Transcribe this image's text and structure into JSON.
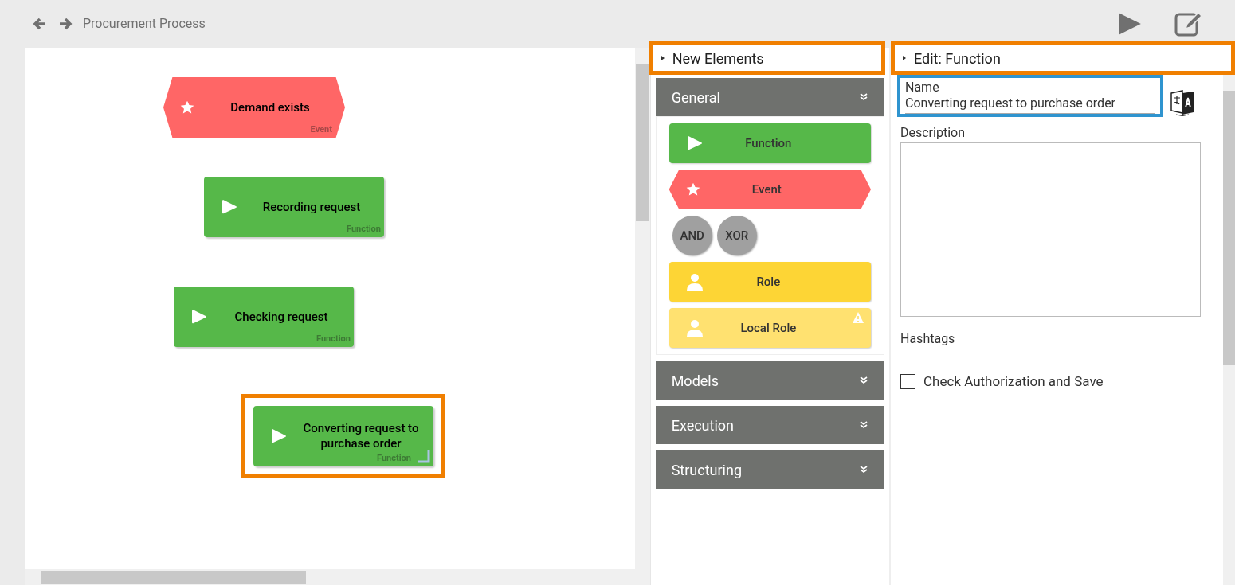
{
  "header": {
    "title": "Procurement Process"
  },
  "canvas": {
    "nodes": [
      {
        "kind": "event",
        "label": "Demand exists",
        "type_label": "Event",
        "selected": false
      },
      {
        "kind": "function",
        "label": "Recording request",
        "type_label": "Function",
        "selected": false
      },
      {
        "kind": "function",
        "label": "Checking request",
        "type_label": "Function",
        "selected": false
      },
      {
        "kind": "function",
        "label": "Converting request to purchase order",
        "type_label": "Function",
        "selected": true
      }
    ]
  },
  "new_elements": {
    "title": "New Elements",
    "sections": [
      {
        "title": "General",
        "expanded": true,
        "items": [
          {
            "kind": "function",
            "label": "Function"
          },
          {
            "kind": "event",
            "label": "Event"
          },
          {
            "kind": "gateways",
            "labels": [
              "AND",
              "XOR"
            ]
          },
          {
            "kind": "role",
            "label": "Role",
            "warning": false
          },
          {
            "kind": "local_role",
            "label": "Local Role",
            "warning": true
          }
        ]
      },
      {
        "title": "Models",
        "expanded": false
      },
      {
        "title": "Execution",
        "expanded": false
      },
      {
        "title": "Structuring",
        "expanded": false
      }
    ]
  },
  "editor": {
    "title": "Edit: Function",
    "name_label": "Name",
    "name_value": "Converting request to purchase order",
    "description_label": "Description",
    "hashtags_label": "Hashtags",
    "check": {
      "label": "Check Authorization and Save",
      "checked": false
    }
  }
}
